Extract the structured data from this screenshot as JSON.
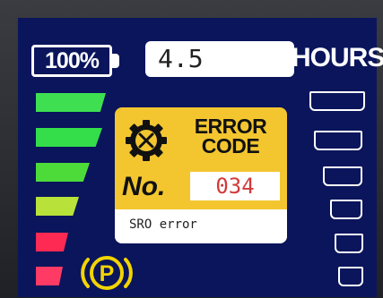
{
  "battery": {
    "level_text": "100%"
  },
  "hours": {
    "value": "4.5",
    "label": "HOURS"
  },
  "error": {
    "title_line1": "ERROR",
    "title_line2": "CODE",
    "number_label": "No.",
    "code": "034",
    "description": "SRO error"
  },
  "indicators": {
    "parking_brake": {
      "letter": "P",
      "icon": "parking-brake-icon"
    },
    "gear_icon": "gear-wrench-icon"
  },
  "colors": {
    "screen_bg": "#0a155c",
    "panel": "#f3c630",
    "green": "#3ee052",
    "yellow_green": "#b8e23a",
    "red": "#ff2a54",
    "parking": "#f3d400"
  }
}
